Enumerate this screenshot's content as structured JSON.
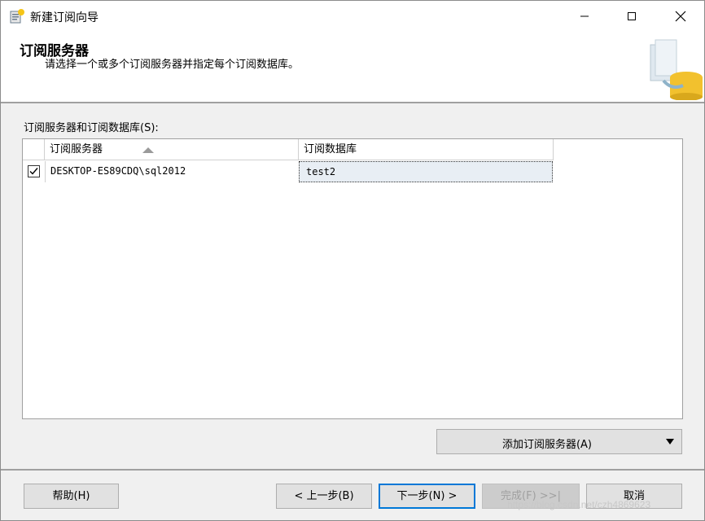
{
  "window": {
    "title": "新建订阅向导"
  },
  "header": {
    "title": "订阅服务器",
    "subtitle": "请选择一个或多个订阅服务器并指定每个订阅数据库。"
  },
  "grid": {
    "label": "订阅服务器和订阅数据库(S):",
    "columns": [
      "订阅服务器",
      "订阅数据库"
    ],
    "rows": [
      {
        "checked": true,
        "server": "DESKTOP-ES89CDQ\\sql2012",
        "database": "test2"
      }
    ]
  },
  "add_button": {
    "label": "添加订阅服务器(A)"
  },
  "footer": {
    "help": "帮助(H)",
    "back": "< 上一步(B)",
    "next": "下一步(N) >",
    "finish": "完成(F) >>|",
    "cancel": "取消"
  },
  "watermark": "https://blog.csdn.net/czh4869623",
  "colors": {
    "accent": "#0078d7",
    "selected_cell": "#e8eef4"
  }
}
